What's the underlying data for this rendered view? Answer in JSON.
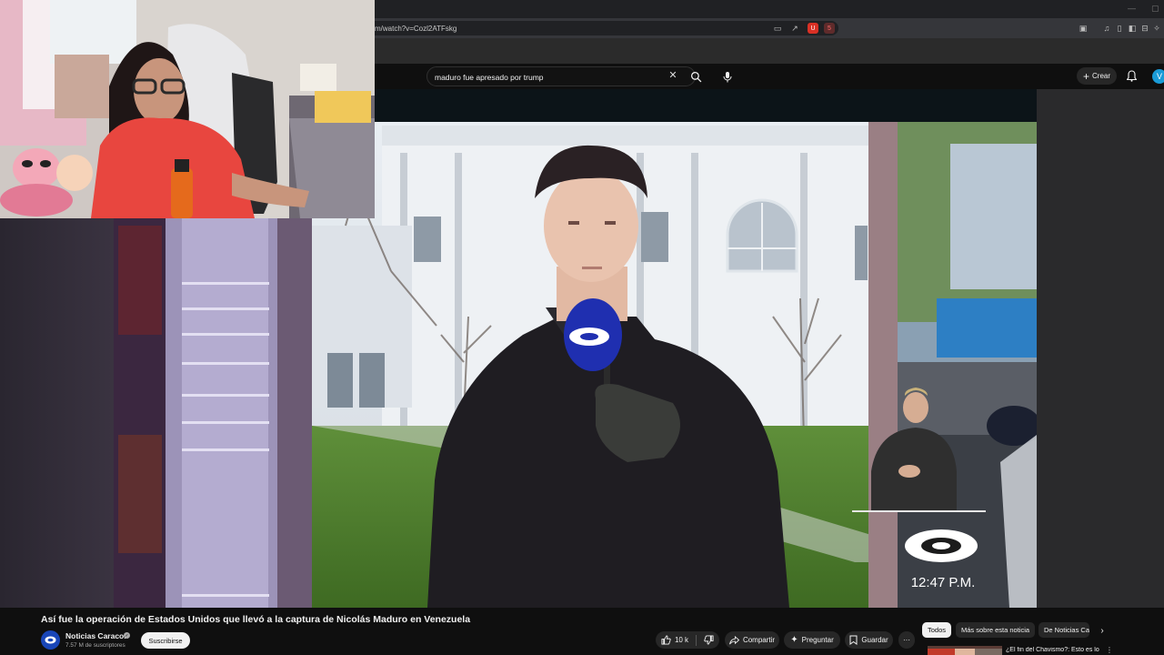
{
  "browser": {
    "url": "m/watch?v=Cozl2ATFskg",
    "extension_badge": "5"
  },
  "header": {
    "search_query": "maduro fue apresado por trump",
    "create_label": "Crear",
    "avatar_letter": "V"
  },
  "video": {
    "broadcast_time": "12:47 P.M."
  },
  "info": {
    "title": "Así fue la operación de Estados Unidos que llevó a la captura de Nicolás Maduro en Venezuela",
    "channel_name": "Noticias Caracol",
    "subscribers": "7.57 M de suscriptores",
    "subscribe_label": "Suscribirse",
    "likes": "10 k",
    "share_label": "Compartir",
    "ask_label": "Preguntar",
    "save_label": "Guardar",
    "more_label": "···"
  },
  "chips": [
    {
      "label": "Todos",
      "active": true
    },
    {
      "label": "Más sobre esta noticia",
      "active": false
    },
    {
      "label": "De Noticias Caracol",
      "active": false
    }
  ],
  "recommendation": {
    "title": "¿El fin del Chavismo?: Esto es lo"
  },
  "colors": {
    "background": "#0f0f0f",
    "pill": "#272727",
    "mic_blue": "#1f2fb0",
    "accent_avatar": "#1a9bd7"
  }
}
